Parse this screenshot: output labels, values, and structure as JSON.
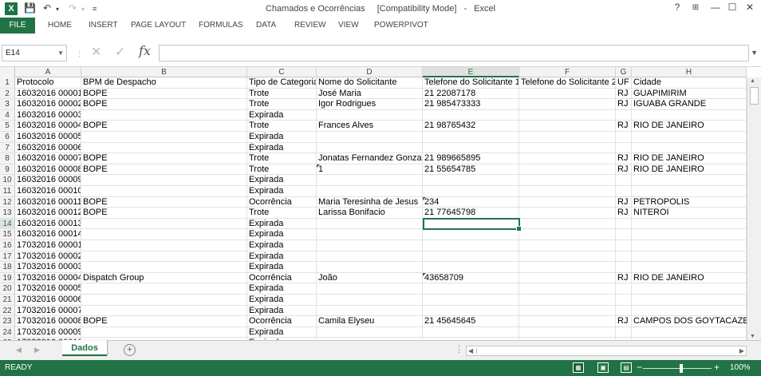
{
  "window": {
    "title": "Chamados e Ocorrências",
    "mode": "[Compatibility Mode]",
    "app": "Excel",
    "help": "?",
    "minimize": "—",
    "restore": "☐",
    "close": "✕"
  },
  "ribbon": {
    "file": "FILE",
    "tabs": [
      "HOME",
      "INSERT",
      "PAGE LAYOUT",
      "FORMULAS",
      "DATA",
      "REVIEW",
      "VIEW",
      "POWERPIVOT"
    ]
  },
  "formula_bar": {
    "name_box": "E14",
    "value": ""
  },
  "columns": [
    "A",
    "B",
    "C",
    "D",
    "E",
    "F",
    "G",
    "H"
  ],
  "active_cell": {
    "col": "E",
    "row": "14"
  },
  "rows": [
    {
      "n": "1",
      "A": "Protocolo",
      "B": "BPM de Despacho",
      "C": "Tipo de Categoria",
      "D": "Nome do Solicitante",
      "E": "Telefone do Solicitante 1",
      "F": "Telefone do Solicitante 2",
      "G": "UF",
      "H": "Cidade"
    },
    {
      "n": "2",
      "A": "16032016 00001",
      "B": "BOPE",
      "C": "Trote",
      "D": "José Maria",
      "E": "21 22087178",
      "F": "",
      "G": "RJ",
      "H": "GUAPIMIRIM"
    },
    {
      "n": "3",
      "A": "16032016 00002",
      "B": "BOPE",
      "C": "Trote",
      "D": "Igor Rodrigues",
      "E": "21 985473333",
      "F": "",
      "G": "RJ",
      "H": "IGUABA GRANDE"
    },
    {
      "n": "4",
      "A": "16032016 00003",
      "B": "",
      "C": "Expirada",
      "D": "",
      "E": "",
      "F": "",
      "G": "",
      "H": ""
    },
    {
      "n": "5",
      "A": "16032016 00004",
      "B": "BOPE",
      "C": "Trote",
      "D": "Frances Alves",
      "E": "21 98765432",
      "F": "",
      "G": "RJ",
      "H": "RIO DE JANEIRO"
    },
    {
      "n": "6",
      "A": "16032016 00005",
      "B": "",
      "C": "Expirada",
      "D": "",
      "E": "",
      "F": "",
      "G": "",
      "H": ""
    },
    {
      "n": "7",
      "A": "16032016 00006",
      "B": "",
      "C": "Expirada",
      "D": "",
      "E": "",
      "F": "",
      "G": "",
      "H": ""
    },
    {
      "n": "8",
      "A": "16032016 00007",
      "B": "BOPE",
      "C": "Trote",
      "D": "Jonatas Fernandez Gonzale",
      "E": "21 989665895",
      "F": "",
      "G": "RJ",
      "H": "RIO DE JANEIRO"
    },
    {
      "n": "9",
      "A": "16032016 00008",
      "B": "BOPE",
      "C": "Trote",
      "D": "1",
      "E": "21 55654785",
      "F": "",
      "G": "RJ",
      "H": "RIO DE JANEIRO",
      "triD": true
    },
    {
      "n": "10",
      "A": "16032016 00009",
      "B": "",
      "C": "Expirada",
      "D": "",
      "E": "",
      "F": "",
      "G": "",
      "H": ""
    },
    {
      "n": "11",
      "A": "16032016 00010",
      "B": "",
      "C": "Expirada",
      "D": "",
      "E": "",
      "F": "",
      "G": "",
      "H": ""
    },
    {
      "n": "12",
      "A": "16032016 00011",
      "B": "BOPE",
      "C": "Ocorrência",
      "D": "Maria Teresinha de Jesus",
      "E": "234",
      "F": "",
      "G": "RJ",
      "H": "PETROPOLIS",
      "triE": true
    },
    {
      "n": "13",
      "A": "16032016 00012",
      "B": "BOPE",
      "C": "Trote",
      "D": "Larissa Bonifacio",
      "E": "21 77645798",
      "F": "",
      "G": "RJ",
      "H": "NITEROI"
    },
    {
      "n": "14",
      "A": "16032016 00013",
      "B": "",
      "C": "Expirada",
      "D": "",
      "E": "",
      "F": "",
      "G": "",
      "H": ""
    },
    {
      "n": "15",
      "A": "16032016 00014",
      "B": "",
      "C": "Expirada",
      "D": "",
      "E": "",
      "F": "",
      "G": "",
      "H": ""
    },
    {
      "n": "16",
      "A": "17032016 00001",
      "B": "",
      "C": "Expirada",
      "D": "",
      "E": "",
      "F": "",
      "G": "",
      "H": ""
    },
    {
      "n": "17",
      "A": "17032016 00002",
      "B": "",
      "C": "Expirada",
      "D": "",
      "E": "",
      "F": "",
      "G": "",
      "H": ""
    },
    {
      "n": "18",
      "A": "17032016 00003",
      "B": "",
      "C": "Expirada",
      "D": "",
      "E": "",
      "F": "",
      "G": "",
      "H": ""
    },
    {
      "n": "19",
      "A": "17032016 00004",
      "B": "Dispatch Group",
      "C": "Ocorrência",
      "D": "João",
      "E": "43658709",
      "F": "",
      "G": "RJ",
      "H": "RIO DE JANEIRO",
      "triE": true
    },
    {
      "n": "20",
      "A": "17032016 00005",
      "B": "",
      "C": "Expirada",
      "D": "",
      "E": "",
      "F": "",
      "G": "",
      "H": ""
    },
    {
      "n": "21",
      "A": "17032016 00006",
      "B": "",
      "C": "Expirada",
      "D": "",
      "E": "",
      "F": "",
      "G": "",
      "H": ""
    },
    {
      "n": "22",
      "A": "17032016 00007",
      "B": "",
      "C": "Expirada",
      "D": "",
      "E": "",
      "F": "",
      "G": "",
      "H": ""
    },
    {
      "n": "23",
      "A": "17032016 00008",
      "B": "BOPE",
      "C": "Ocorrência",
      "D": "Camila Elyseu",
      "E": "21 45645645",
      "F": "",
      "G": "RJ",
      "H": "CAMPOS DOS GOYTACAZES"
    },
    {
      "n": "24",
      "A": "17032016 00009",
      "B": "",
      "C": "Expirada",
      "D": "",
      "E": "",
      "F": "",
      "G": "",
      "H": ""
    },
    {
      "n": "25",
      "A": "17032016 00010",
      "B": "",
      "C": "Expirada",
      "D": "",
      "E": "",
      "F": "",
      "G": "",
      "H": ""
    }
  ],
  "sheets": {
    "active": "Dados",
    "add": "+"
  },
  "status": {
    "ready": "READY",
    "zoom": "100%"
  },
  "colors": {
    "excel_green": "#217346"
  }
}
